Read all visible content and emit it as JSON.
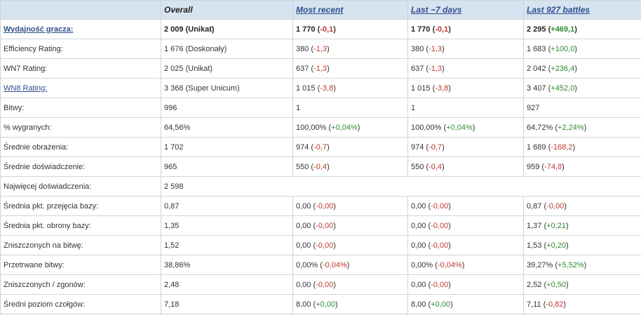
{
  "header": {
    "col0": "",
    "overall": "Overall",
    "most_recent": "Most recent",
    "last_7_days": "Last ~7 days",
    "last_battles": "Last 927 battles"
  },
  "rows": [
    {
      "label": "Wydajność gracza:",
      "link": true,
      "overall": "2 009 (Unikat)",
      "recent": "1 770",
      "recent_d": "-0,1",
      "recent_s": "neg",
      "week": "1 770",
      "week_d": "-0,1",
      "week_s": "neg",
      "last": "2 295",
      "last_d": "+469,1",
      "last_s": "pos"
    },
    {
      "label": "Efficiency Rating:",
      "link": false,
      "overall": "1 676 (Doskonały)",
      "recent": "380",
      "recent_d": "-1,3",
      "recent_s": "neg",
      "week": "380",
      "week_d": "-1,3",
      "week_s": "neg",
      "last": "1 683",
      "last_d": "+100,0",
      "last_s": "pos"
    },
    {
      "label": "WN7 Rating:",
      "link": false,
      "overall": "2 025 (Unikat)",
      "recent": "637",
      "recent_d": "-1,3",
      "recent_s": "neg",
      "week": "637",
      "week_d": "-1,3",
      "week_s": "neg",
      "last": "2 042",
      "last_d": "+236,4",
      "last_s": "pos"
    },
    {
      "label": "WN8 Rating:",
      "link": true,
      "overall": "3 368 (Super Unicum)",
      "recent": "1 015",
      "recent_d": "-3,8",
      "recent_s": "neg",
      "week": "1 015",
      "week_d": "-3,8",
      "week_s": "neg",
      "last": "3 407",
      "last_d": "+452,0",
      "last_s": "pos"
    },
    {
      "label": "Bitwy:",
      "link": false,
      "overall": "996",
      "recent": "1",
      "recent_d": "",
      "recent_s": "",
      "week": "1",
      "week_d": "",
      "week_s": "",
      "last": "927",
      "last_d": "",
      "last_s": ""
    },
    {
      "label": "% wygranych:",
      "link": false,
      "overall": "64,56%",
      "recent": "100,00%",
      "recent_d": "+0,04%",
      "recent_s": "pos",
      "week": "100,00%",
      "week_d": "+0,04%",
      "week_s": "pos",
      "last": "64,72%",
      "last_d": "+2,24%",
      "last_s": "pos"
    },
    {
      "label": "Średnie obrażenia:",
      "link": false,
      "overall": "1 702",
      "recent": "974",
      "recent_d": "-0,7",
      "recent_s": "neg",
      "week": "974",
      "week_d": "-0,7",
      "week_s": "neg",
      "last": "1 689",
      "last_d": "-168,2",
      "last_s": "neg"
    },
    {
      "label": "Średnie doświadczenie:",
      "link": false,
      "overall": "965",
      "recent": "550",
      "recent_d": "-0,4",
      "recent_s": "neg",
      "week": "550",
      "week_d": "-0,4",
      "week_s": "neg",
      "last": "959",
      "last_d": "-74,8",
      "last_s": "neg"
    },
    {
      "label": "Najwięcej doświadczenia:",
      "link": false,
      "span": true,
      "overall": "2 598"
    },
    {
      "label": "Średnia pkt. przejęcia bazy:",
      "link": false,
      "overall": "0,87",
      "recent": "0,00",
      "recent_d": "-0,00",
      "recent_s": "neg",
      "week": "0,00",
      "week_d": "-0,00",
      "week_s": "neg",
      "last": "0,87",
      "last_d": "-0,00",
      "last_s": "neg"
    },
    {
      "label": "Średnia pkt. obrony bazy:",
      "link": false,
      "overall": "1,35",
      "recent": "0,00",
      "recent_d": "-0,00",
      "recent_s": "neg",
      "week": "0,00",
      "week_d": "-0,00",
      "week_s": "neg",
      "last": "1,37",
      "last_d": "+0,21",
      "last_s": "pos"
    },
    {
      "label": "Zniszczonych na bitwę:",
      "link": false,
      "overall": "1,52",
      "recent": "0,00",
      "recent_d": "-0,00",
      "recent_s": "neg",
      "week": "0,00",
      "week_d": "-0,00",
      "week_s": "neg",
      "last": "1,53",
      "last_d": "+0,20",
      "last_s": "pos"
    },
    {
      "label": "Przetrwane bitwy:",
      "link": false,
      "overall": "38,86%",
      "recent": "0,00%",
      "recent_d": "-0,04%",
      "recent_s": "neg",
      "week": "0,00%",
      "week_d": "-0,04%",
      "week_s": "neg",
      "last": "39,27%",
      "last_d": "+5,52%",
      "last_s": "pos"
    },
    {
      "label": "Zniszczonych / zgonów:",
      "link": false,
      "overall": "2,48",
      "recent": "0,00",
      "recent_d": "-0,00",
      "recent_s": "neg",
      "week": "0,00",
      "week_d": "-0,00",
      "week_s": "neg",
      "last": "2,52",
      "last_d": "+0,50",
      "last_s": "pos"
    },
    {
      "label": "Średni poziom czołgów:",
      "link": false,
      "overall": "7,18",
      "recent": "8,00",
      "recent_d": "+0,00",
      "recent_s": "pos",
      "week": "8,00",
      "week_d": "+0,00",
      "week_s": "pos",
      "last": "7,11",
      "last_d": "-0,82",
      "last_s": "neg"
    }
  ],
  "colors": {
    "header_bg": "#d6e3f0",
    "link": "#2f4f8f",
    "negative": "#c0392b",
    "positive": "#2e8b2e",
    "border": "#cfd4da"
  }
}
